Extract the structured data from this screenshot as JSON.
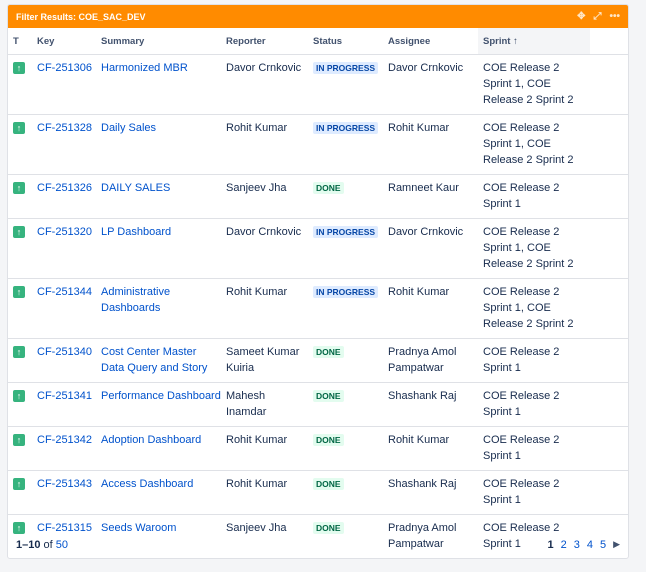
{
  "gadget": {
    "title": "Filter Results: COE_SAC_DEV",
    "tools": {
      "move": "✥",
      "expand": "⤢",
      "more": "•••"
    }
  },
  "table": {
    "headers": {
      "type": "T",
      "key": "Key",
      "summary": "Summary",
      "reporter": "Reporter",
      "status": "Status",
      "assignee": "Assignee",
      "sprint": "Sprint"
    },
    "sort_indicator": "↑",
    "rows": [
      {
        "type_icon": "story-icon",
        "key": "CF-251306",
        "summary": "Harmonized MBR",
        "reporter": "Davor Crnkovic",
        "status": "IN PROGRESS",
        "status_kind": "inprogress",
        "assignee": "Davor Crnkovic",
        "sprint": "COE Release 2 Sprint 1, COE Release 2 Sprint 2"
      },
      {
        "type_icon": "story-icon",
        "key": "CF-251328",
        "summary": "Daily Sales",
        "reporter": "Rohit Kumar",
        "status": "IN PROGRESS",
        "status_kind": "inprogress",
        "assignee": "Rohit Kumar",
        "sprint": "COE Release 2 Sprint 1, COE Release 2 Sprint 2"
      },
      {
        "type_icon": "story-icon",
        "key": "CF-251326",
        "summary": "DAILY SALES",
        "reporter": "Sanjeev Jha",
        "status": "DONE",
        "status_kind": "done",
        "assignee": "Ramneet Kaur",
        "sprint": "COE Release 2 Sprint 1"
      },
      {
        "type_icon": "story-icon",
        "key": "CF-251320",
        "summary": "LP Dashboard",
        "reporter": "Davor Crnkovic",
        "status": "IN PROGRESS",
        "status_kind": "inprogress",
        "assignee": "Davor Crnkovic",
        "sprint": "COE Release 2 Sprint 1, COE Release 2 Sprint 2"
      },
      {
        "type_icon": "story-icon",
        "key": "CF-251344",
        "summary": "Administrative Dashboards",
        "reporter": "Rohit Kumar",
        "status": "IN PROGRESS",
        "status_kind": "inprogress",
        "assignee": "Rohit Kumar",
        "sprint": "COE Release 2 Sprint 1, COE Release 2 Sprint 2"
      },
      {
        "type_icon": "story-icon",
        "key": "CF-251340",
        "summary": "Cost Center Master Data Query and Story",
        "reporter": "Sameet Kumar Kuiria",
        "status": "DONE",
        "status_kind": "done",
        "assignee": "Pradnya Amol Pampatwar",
        "sprint": "COE Release 2 Sprint 1"
      },
      {
        "type_icon": "story-icon",
        "key": "CF-251341",
        "summary": "Performance Dashboard",
        "reporter": "Mahesh Inamdar",
        "status": "DONE",
        "status_kind": "done",
        "assignee": "Shashank Raj",
        "sprint": "COE Release 2 Sprint 1"
      },
      {
        "type_icon": "story-icon",
        "key": "CF-251342",
        "summary": "Adoption Dashboard",
        "reporter": "Rohit Kumar",
        "status": "DONE",
        "status_kind": "done",
        "assignee": "Rohit Kumar",
        "sprint": "COE Release 2 Sprint 1"
      },
      {
        "type_icon": "story-icon",
        "key": "CF-251343",
        "summary": "Access Dashboard",
        "reporter": "Rohit Kumar",
        "status": "DONE",
        "status_kind": "done",
        "assignee": "Shashank Raj",
        "sprint": "COE Release 2 Sprint 1"
      },
      {
        "type_icon": "story-icon",
        "key": "CF-251315",
        "summary": "Seeds Waroom",
        "reporter": "Sanjeev Jha",
        "status": "DONE",
        "status_kind": "done",
        "assignee": "Pradnya Amol Pampatwar",
        "sprint": "COE Release 2 Sprint 1"
      }
    ]
  },
  "footer": {
    "range": "1–10",
    "of": "of",
    "total": "50",
    "pages": [
      "1",
      "2",
      "3",
      "4",
      "5"
    ],
    "current_page": "1",
    "next": "▶"
  },
  "colors": {
    "header": "#ff8b00",
    "link": "#0052cc",
    "story_icon": "#36b37e",
    "inprogress_bg": "#deebff",
    "done_bg": "#e3fcef"
  }
}
